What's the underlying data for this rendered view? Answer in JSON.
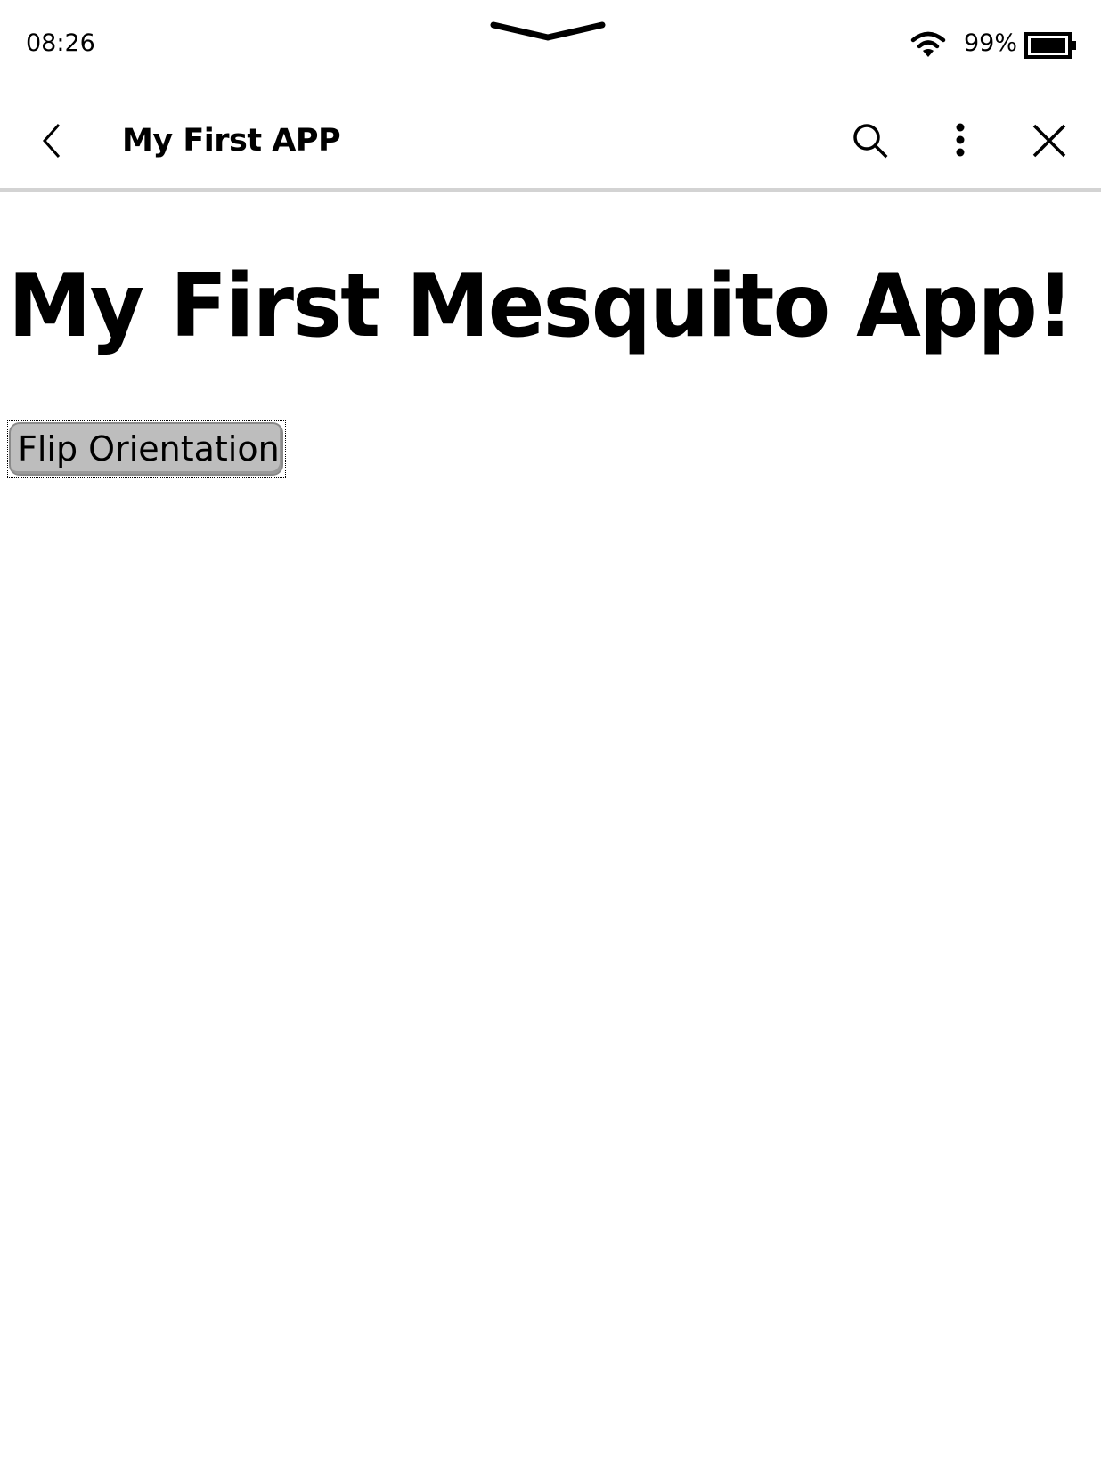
{
  "status_bar": {
    "time": "08:26",
    "battery_percent_label": "99%",
    "battery_level": 0.99,
    "icons": {
      "pull_handle": "chevron-down-icon",
      "wifi": "wifi-icon",
      "battery": "battery-icon"
    }
  },
  "header": {
    "title": "My First APP",
    "icons": {
      "back": "chevron-left-icon",
      "search": "search-icon",
      "more": "more-vertical-icon",
      "close": "close-icon"
    }
  },
  "main": {
    "heading": "My First Mesquito App!",
    "flip_button_label": "Flip Orientation"
  },
  "colors": {
    "text": "#000000",
    "background": "#ffffff",
    "divider": "#d3d3d3",
    "button_bg": "#bdbdbd",
    "button_border": "#8a8a8a"
  }
}
